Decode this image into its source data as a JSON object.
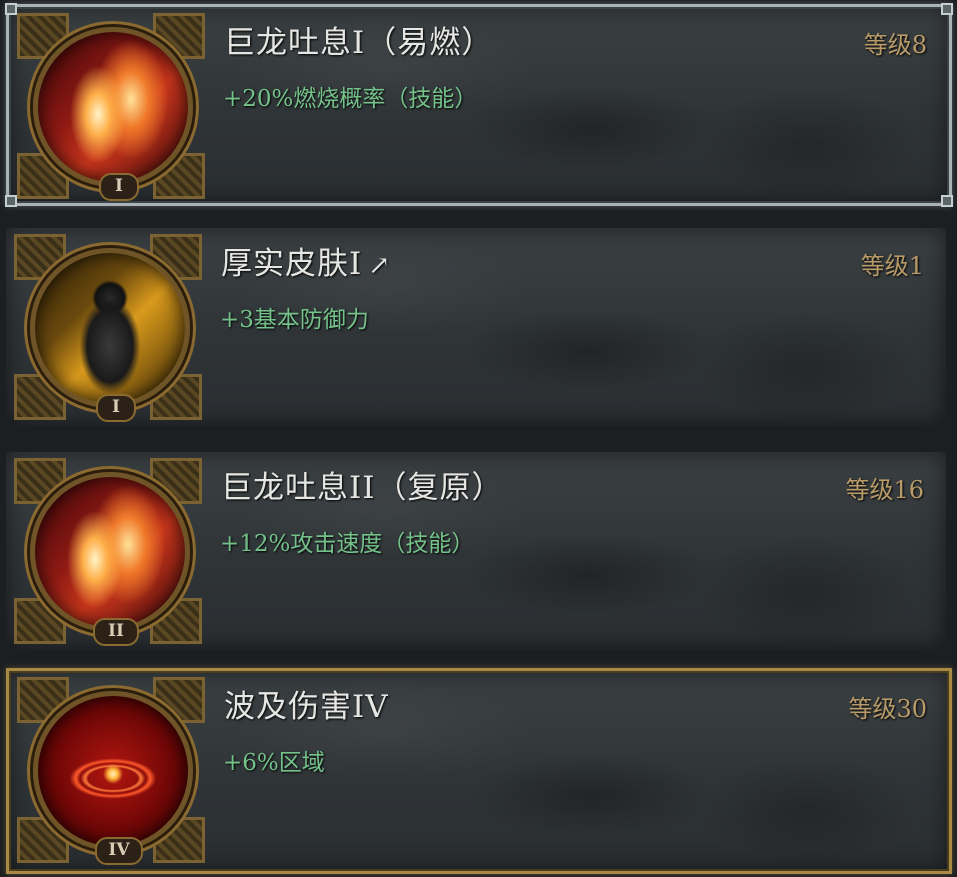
{
  "skills": [
    {
      "title": "巨龙吐息I（易燃）",
      "effect": "+20%燃烧概率（技能）",
      "level": "等级8",
      "rank": "I",
      "icon": "flame-icon",
      "state": "selected"
    },
    {
      "title": "厚实皮肤I",
      "effect": "+3基本防御力",
      "level": "等级1",
      "rank": "I",
      "icon": "armored-body-icon",
      "arrow": "↗"
    },
    {
      "title": "巨龙吐息II（复原）",
      "effect": "+12%攻击速度（技能）",
      "level": "等级16",
      "rank": "II",
      "icon": "flame-icon"
    },
    {
      "title": "波及伤害IV",
      "effect": "+6%区域",
      "level": "等级30",
      "rank": "IV",
      "icon": "fire-ring-icon",
      "state": "highlighted"
    }
  ],
  "colors": {
    "title": "#e6e6e2",
    "effect": "#74c28a",
    "level": "#b89b68",
    "silver_border": "#a9b2b6",
    "gold_border": "#a88a45"
  }
}
